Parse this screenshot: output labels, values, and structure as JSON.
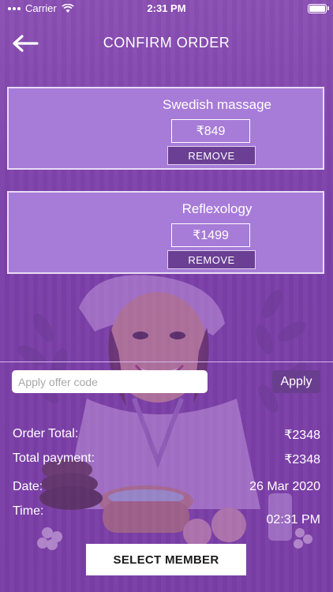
{
  "status_bar": {
    "carrier": "Carrier",
    "time": "2:31 PM"
  },
  "header": {
    "title": "CONFIRM ORDER",
    "back_icon": "arrow-left-icon"
  },
  "services": [
    {
      "name": "Swedish massage",
      "price": "₹849",
      "remove_label": "REMOVE"
    },
    {
      "name": "Reflexology",
      "price": "₹1499",
      "remove_label": "REMOVE"
    }
  ],
  "offer": {
    "placeholder": "Apply offer code",
    "value": "",
    "apply_label": "Apply"
  },
  "summary": {
    "order_total_label": "Order Total:",
    "order_total_value": "₹2348",
    "total_payment_label": "Total payment:",
    "total_payment_value": "₹2348",
    "date_label": "Date:",
    "date_value": "26 Mar 2020",
    "time_label": "Time:",
    "time_value": "02:31 PM"
  },
  "footer": {
    "select_member_label": "SELECT MEMBER"
  },
  "colors": {
    "background": "#7b3fa8",
    "card": "#a77bd8",
    "remove_button": "#6b3f93",
    "apply_button": "#6a3e8f"
  }
}
